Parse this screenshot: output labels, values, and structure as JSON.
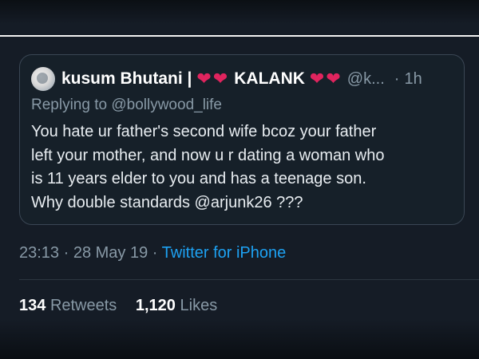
{
  "quoted_tweet": {
    "author_name": "kusum Bhutani |",
    "decoration_text": "KALANK",
    "handle": "@k...",
    "time_sep": "·",
    "time": "1h",
    "replying_prefix": "Replying to",
    "replying_handle": "@bollywood_life",
    "lines": [
      "You hate ur father's second wife bcoz your father",
      "left your mother, and now u r dating a woman who",
      "is 11 years elder to you and has a teenage son.",
      "Why double standards @arjunk26 ???"
    ]
  },
  "meta": {
    "timestamp": "23:13 · 28 May 19 ·",
    "source": "Twitter for iPhone"
  },
  "stats": {
    "retweets_count": "134",
    "retweets_label": "Retweets",
    "likes_count": "1,120",
    "likes_label": "Likes"
  },
  "colors": {
    "background": "#151c26",
    "heart": "#e0245e",
    "link": "#1da1f2",
    "muted": "#8899a6"
  },
  "icons": {
    "heart": "heart-icon",
    "avatar": "avatar"
  }
}
